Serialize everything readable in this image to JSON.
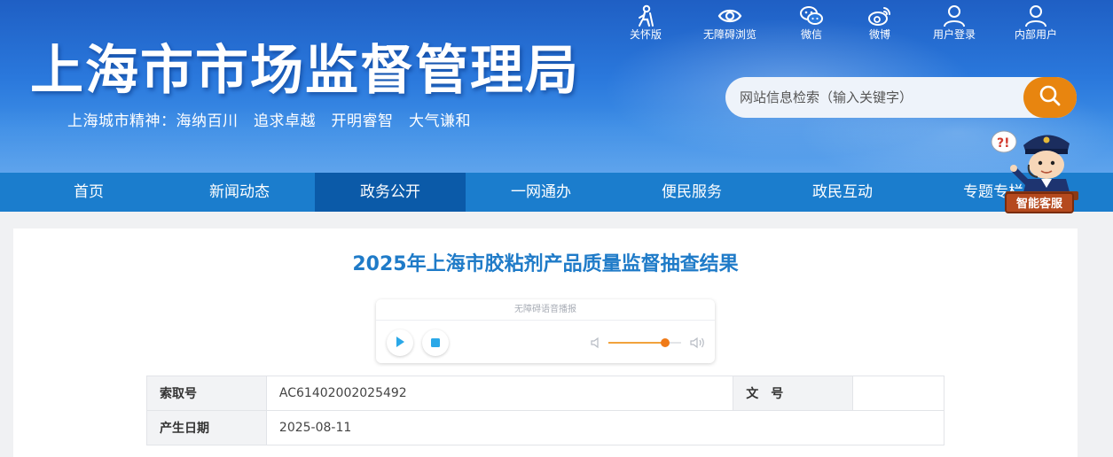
{
  "header": {
    "title": "上海市市场监督管理局",
    "spirit": "上海城市精神：海纳百川　追求卓越　开明睿智　大气谦和",
    "links": [
      {
        "label": "关怀版",
        "icon": "elderly-care-icon"
      },
      {
        "label": "无障碍浏览",
        "icon": "eye-icon"
      },
      {
        "label": "微信",
        "icon": "wechat-icon"
      },
      {
        "label": "微博",
        "icon": "weibo-icon"
      },
      {
        "label": "用户登录",
        "icon": "user-icon"
      },
      {
        "label": "内部用户",
        "icon": "internal-user-icon"
      }
    ]
  },
  "search": {
    "placeholder": "网站信息检索（输入关键字）",
    "icon": "search-icon"
  },
  "nav": {
    "items": [
      {
        "label": "首页"
      },
      {
        "label": "新闻动态"
      },
      {
        "label": "政务公开"
      },
      {
        "label": "一网通办"
      },
      {
        "label": "便民服务"
      },
      {
        "label": "政民互动"
      },
      {
        "label": "专题专栏"
      }
    ],
    "active": "政务公开"
  },
  "mascot": {
    "label": "智能客服"
  },
  "article": {
    "title": "2025年上海市胶粘剂产品质量监督抽查结果"
  },
  "player": {
    "title": "无障碍语音播报",
    "volume": 0.78
  },
  "info": {
    "index_label": "索取号",
    "index_value": "AC61402002025492",
    "doc_label": "文　号",
    "doc_value": "",
    "date_label": "产生日期",
    "date_value": "2025-08-11"
  },
  "colors": {
    "header_blue": "#2a78dc",
    "nav_blue": "#1b7dcd",
    "nav_active": "#0b5aa8",
    "accent_orange": "#e8850f",
    "title_blue": "#1f7bc8"
  }
}
